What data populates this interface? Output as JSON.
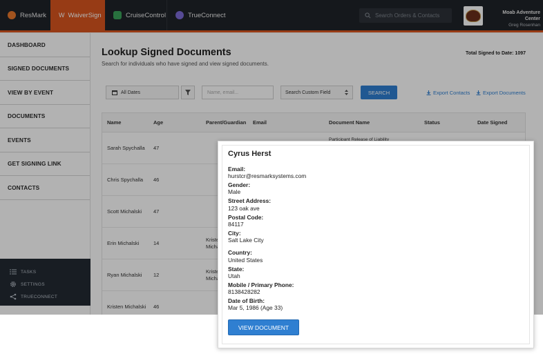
{
  "topbar": {
    "tabs": [
      {
        "label": "ResMark",
        "icon": "resmark-logo-icon"
      },
      {
        "label": "WaiverSign",
        "icon": "waiversign-logo-icon",
        "active": true
      },
      {
        "label": "CruiseControl",
        "icon": "cruisecontrol-logo-icon"
      },
      {
        "label": "TrueConnect",
        "icon": "trueconnect-logo-icon"
      }
    ],
    "search_placeholder": "Search Orders & Contacts",
    "company": "Moab Adventure Center",
    "user": "Greg Rosenhan",
    "accent_color": "#d8551f"
  },
  "sidebar": {
    "items": [
      {
        "label": "DASHBOARD"
      },
      {
        "label": "SIGNED DOCUMENTS"
      },
      {
        "label": "VIEW BY EVENT"
      },
      {
        "label": "DOCUMENTS"
      },
      {
        "label": "EVENTS"
      },
      {
        "label": "GET SIGNING LINK"
      },
      {
        "label": "CONTACTS"
      }
    ],
    "bottom_items": [
      {
        "label": "TASKS",
        "icon": "tasks-icon"
      },
      {
        "label": "SETTINGS",
        "icon": "gear-icon"
      },
      {
        "label": "TRUECONNECT",
        "icon": "share-icon"
      }
    ]
  },
  "main": {
    "title": "Lookup Signed Documents",
    "subtitle": "Search for individuals who have signed and view signed documents.",
    "total": "Total Signed to Date: 1097",
    "filters": {
      "date": "All Dates",
      "name_placeholder": "Name, email...",
      "custom_field": "Search Custom Field",
      "search_label": "SEARCH"
    },
    "exports": {
      "contacts": "Export Contacts",
      "documents": "Export Documents"
    },
    "table": {
      "headers": [
        "Name",
        "Age",
        "Parent/Guardian",
        "Email",
        "Document Name",
        "Status",
        "Date Signed"
      ],
      "doc_partial": "Participant Release of Liability",
      "rows": [
        {
          "name": "Sarah Spychalla",
          "age": "47",
          "parent": ""
        },
        {
          "name": "Chris Spychalla",
          "age": "46",
          "parent": ""
        },
        {
          "name": "Scott Michalski",
          "age": "47",
          "parent": ""
        },
        {
          "name": "Erin Michalski",
          "age": "14",
          "parent": "Kristen Michalski"
        },
        {
          "name": "Ryan Michalski",
          "age": "12",
          "parent": "Kristen Michalski"
        },
        {
          "name": "Kristen Michalski",
          "age": "46",
          "parent": ""
        }
      ]
    }
  },
  "modal": {
    "title": "Cyrus Herst",
    "fields": [
      {
        "label": "Email:",
        "value": "hurstcr@resmarksystems.com"
      },
      {
        "label": "Gender:",
        "value": "Male"
      },
      {
        "label": "Street Address:",
        "value": "123 oak ave"
      },
      {
        "label": "Postal Code:",
        "value": "84117"
      },
      {
        "label": "City:",
        "value": "Salt Lake City"
      },
      {
        "label": "Country:",
        "value": "United States"
      },
      {
        "label": "State:",
        "value": "Utah"
      },
      {
        "label": "Mobile / Primary Phone:",
        "value": "8138428282"
      },
      {
        "label": "Date of Birth:",
        "value": "Mar 5, 1986 (Age 33)"
      }
    ],
    "button_label": "VIEW DOCUMENT",
    "button_color": "#2f7fd1"
  }
}
